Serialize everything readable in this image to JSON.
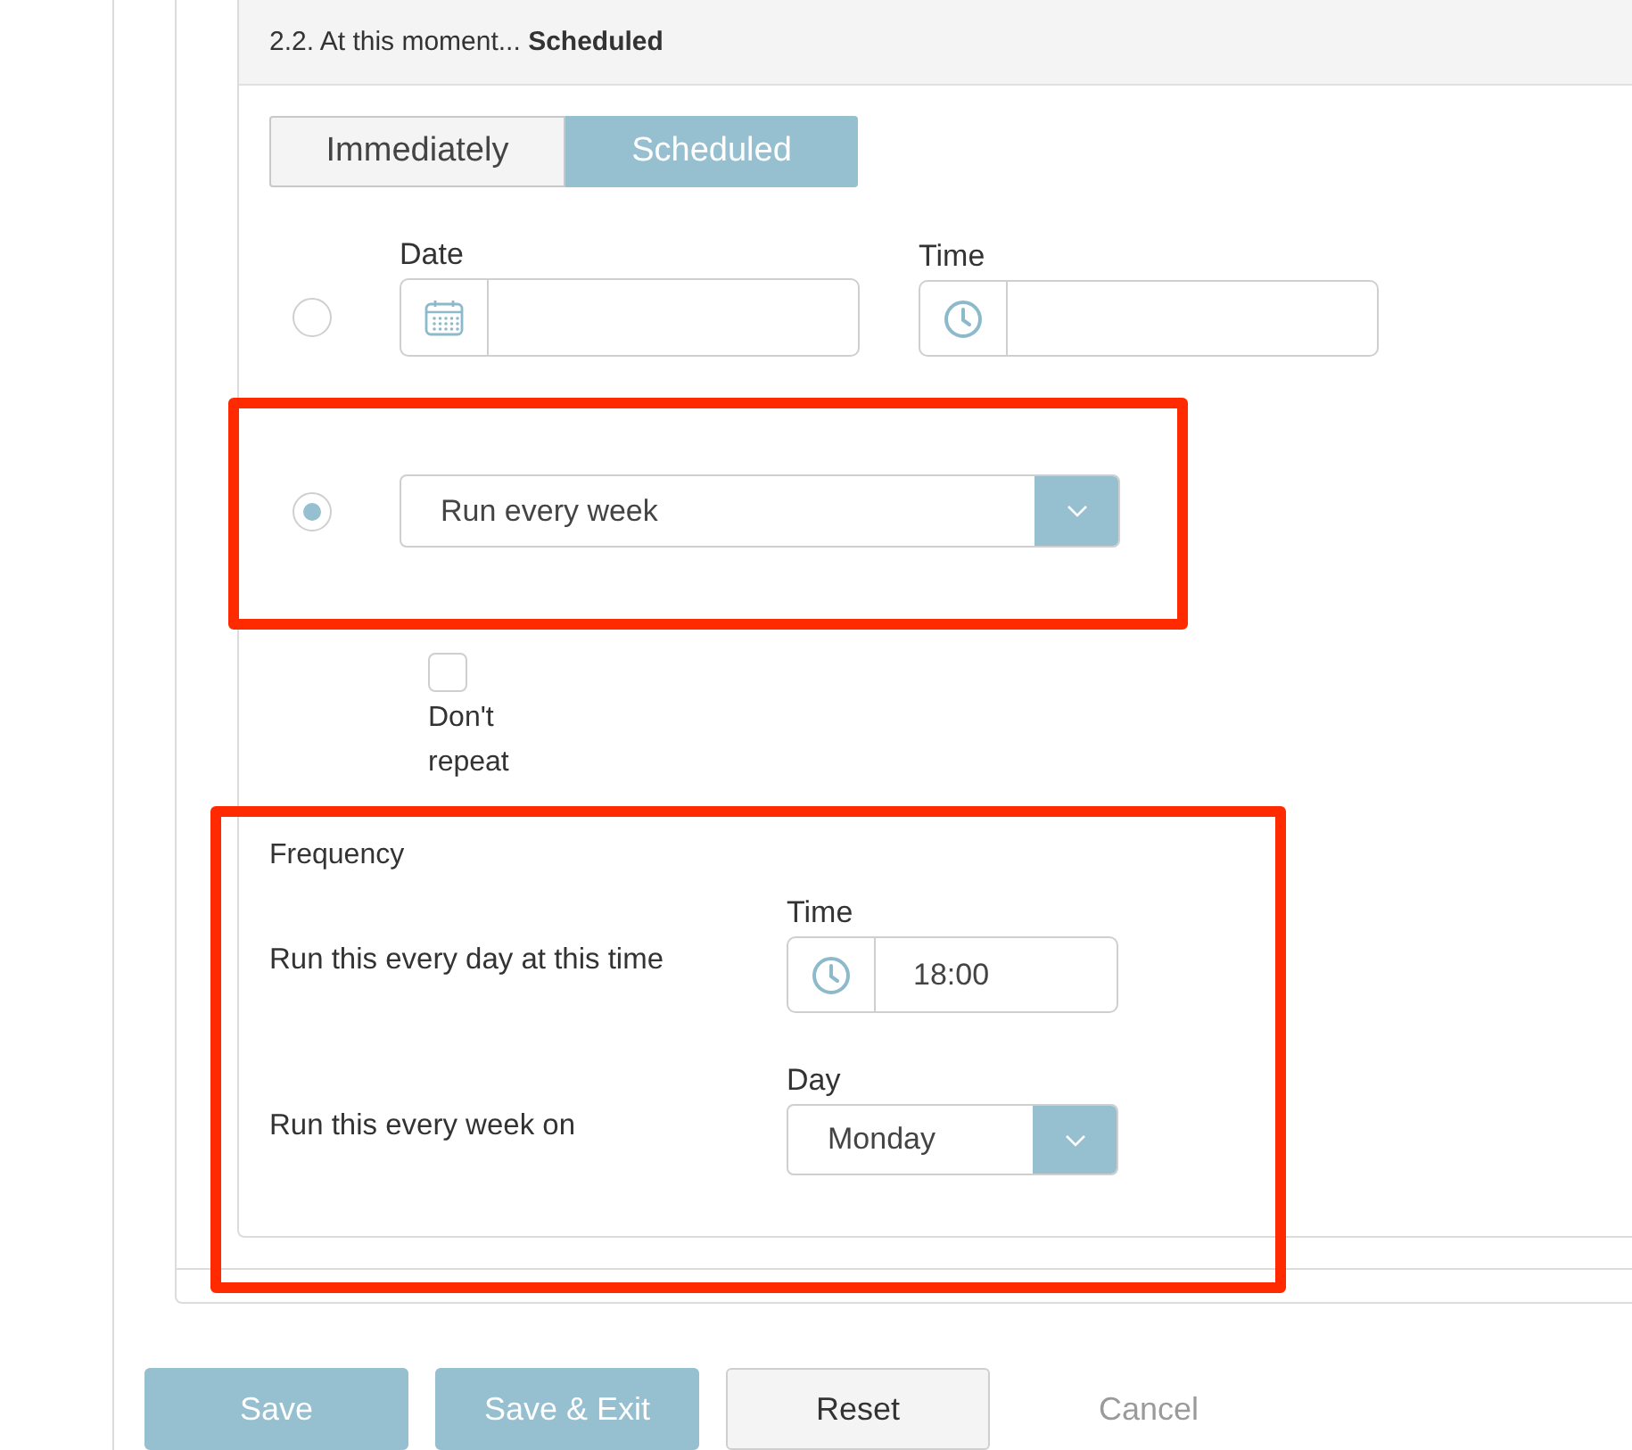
{
  "section": {
    "title": "2.2. At this moment... **Scheduled**"
  },
  "timing_toggle": [
    {
      "label": "Immediately",
      "selected": false
    },
    {
      "label": "Scheduled",
      "selected": true
    }
  ],
  "schedule_options": [
    {
      "kind": "date-time",
      "selected": false,
      "fields": [
        {
          "kind": "date",
          "label": "Date"
        },
        {
          "kind": "time",
          "label": "Time"
        }
      ]
    },
    {
      "kind": "dropdown",
      "selected": true,
      "highlighted": true,
      "value": "Run every week"
    }
  ],
  "dont_repeat": {
    "label": "Don't repeat",
    "checked": false
  },
  "frequency": {
    "title": "Frequency",
    "highlighted": true,
    "rows": [
      {
        "label": "Run this every day at this time",
        "field": {
          "kind": "time",
          "label": "Time",
          "value": "18:00"
        }
      },
      {
        "label": "Run this every week on",
        "field": {
          "kind": "select",
          "label": "Day",
          "value": "Monday"
        }
      }
    ]
  },
  "buttons": [
    {
      "kind": "primary",
      "label": "Save"
    },
    {
      "kind": "primary",
      "label": "Save & Exit"
    },
    {
      "kind": "secondary",
      "label": "Reset"
    },
    {
      "kind": "link",
      "label": "Cancel"
    }
  ]
}
